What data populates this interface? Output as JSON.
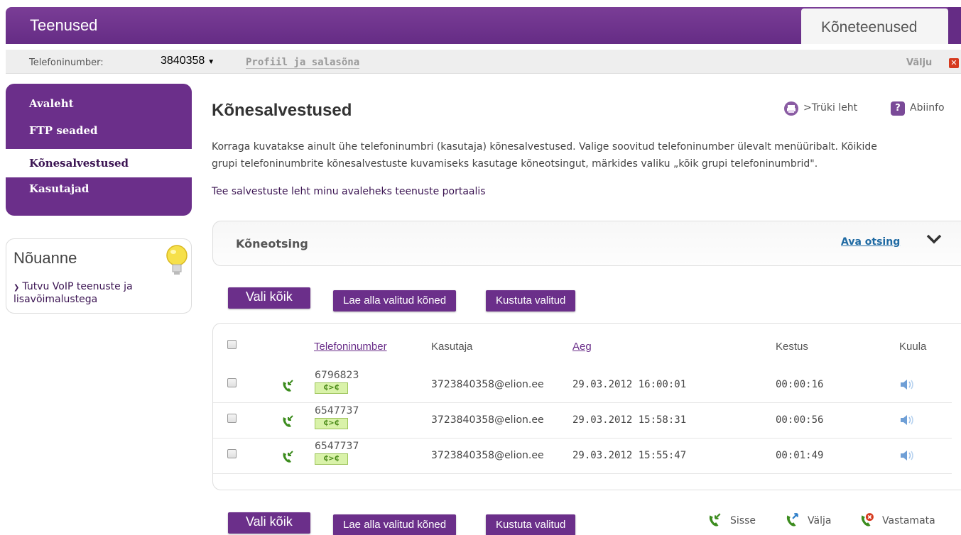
{
  "header": {
    "title": "Teenused",
    "active_tab": "Kõneteenused"
  },
  "subbar": {
    "phone_label": "Telefoninumber:",
    "phone_value": "3840358",
    "profile_link": "Profiil ja salasõna",
    "logout": "Välju"
  },
  "sidebar": {
    "items": [
      {
        "label": "Avaleht",
        "active": false
      },
      {
        "label": "FTP seaded",
        "active": false
      },
      {
        "label": "Kõnesalvestused",
        "active": true
      },
      {
        "label": "Kasutajad",
        "active": false
      }
    ]
  },
  "tip": {
    "title": "Nõuanne",
    "link": "Tutvu VoIP teenuste ja lisavõimalustega"
  },
  "main": {
    "title": "Kõnesalvestused",
    "print": ">Trüki leht",
    "help": "Abiinfo",
    "intro_line1": "Korraga kuvatakse ainult ühe telefoninumbri (kasutaja) kõnesalvestused. Valige soovitud telefoninumber ülevalt menüüribalt. Kõikide",
    "intro_line2": "grupi telefoninumbrite kõnesalvestuste kuvamiseks kasutage kõneotsingut, märkides valiku „kõik grupi telefoninumbrid\".",
    "home_link": "Tee salvestuste leht minu avaleheks teenuste portaalis"
  },
  "search": {
    "title": "Kõneotsing",
    "open": "Ava otsing"
  },
  "actions": {
    "select_all": "Vali kõik",
    "download": "Lae alla valitud kõned",
    "delete": "Kustuta valitud"
  },
  "table": {
    "headers": {
      "phone": "Telefoninumber",
      "user": "Kasutaja",
      "time": "Aeg",
      "duration": "Kestus",
      "listen": "Kuula"
    },
    "rows": [
      {
        "number": "6796823",
        "user": "3723840358@elion.ee",
        "time": "29.03.2012 16:00:01",
        "duration": "00:00:16"
      },
      {
        "number": "6547737",
        "user": "3723840358@elion.ee",
        "time": "29.03.2012 15:58:31",
        "duration": "00:00:56"
      },
      {
        "number": "6547737",
        "user": "3723840358@elion.ee",
        "time": "29.03.2012 15:55:47",
        "duration": "00:01:49"
      }
    ],
    "transfer_badge": "₵>₵"
  },
  "legend": {
    "incoming": "Sisse",
    "outgoing": "Välja",
    "missed": "Vastamata"
  },
  "colors": {
    "brand": "#6b2f8a",
    "link": "#1f6aa3",
    "call_green": "#3c8c1e"
  }
}
